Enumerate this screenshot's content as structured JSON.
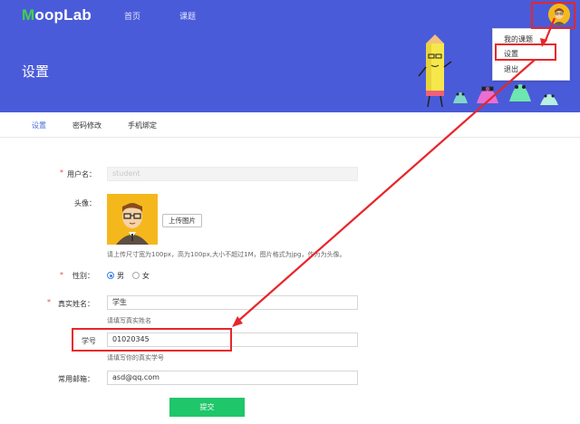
{
  "app": {
    "logo_first": "M",
    "logo_rest": "oopLab",
    "nav": [
      "首页",
      "课题"
    ]
  },
  "banner": {
    "title": "设置"
  },
  "dropdown": {
    "items": [
      "我的课题",
      "设置",
      "退出"
    ]
  },
  "tabs": [
    "设置",
    "密码修改",
    "手机绑定"
  ],
  "form": {
    "username": {
      "label": "用户名：",
      "value": "student"
    },
    "avatar": {
      "label": "头像：",
      "upload_label": "上传图片",
      "hint": "请上传尺寸宽为100px，高为100px,大小不超过1M，图片格式为jpg，作为为头像。"
    },
    "gender": {
      "label": "性别：",
      "options": [
        "男",
        "女"
      ],
      "selected": "男"
    },
    "real_name": {
      "label": "真实姓名：",
      "value": "学生",
      "hint": "请填写真实姓名"
    },
    "student_id": {
      "label": "学号",
      "value": "01020345",
      "hint": "请填写你的真实学号"
    },
    "email": {
      "label": "常用邮箱：",
      "value": "asd@qq.com"
    },
    "required_mark": "*",
    "submit_label": "提交"
  },
  "colors": {
    "primary": "#4a5bd9",
    "logo_accent": "#3fd14a",
    "submit": "#1fc66a",
    "annotation": "#e8262b",
    "tab_active": "#4a6bd9"
  }
}
